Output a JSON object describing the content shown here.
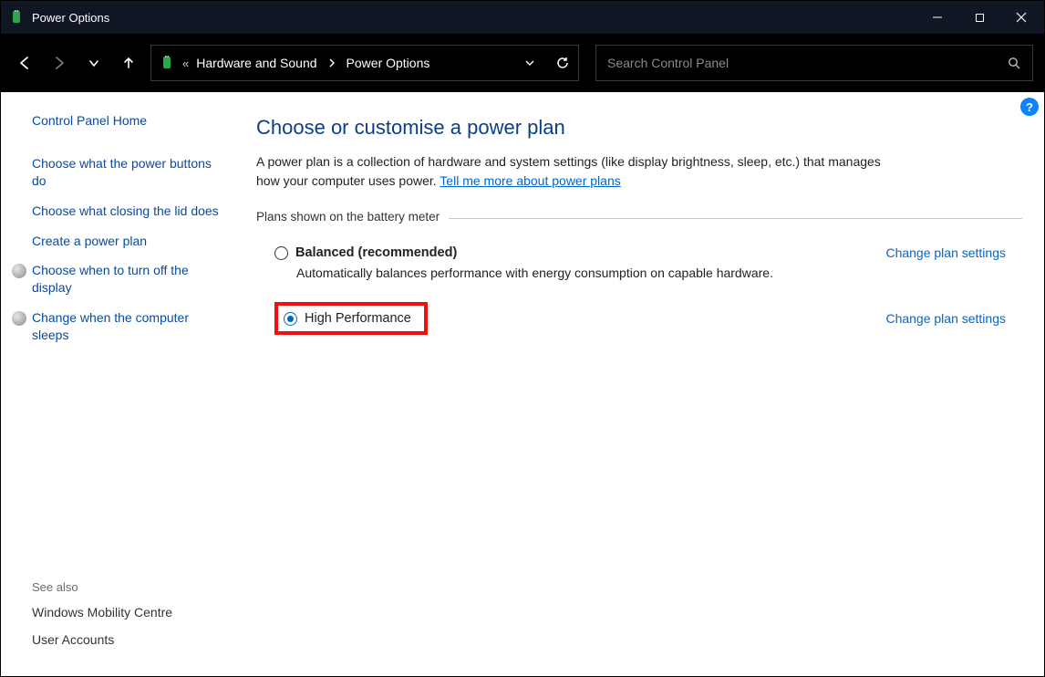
{
  "window": {
    "title": "Power Options"
  },
  "breadcrumb": {
    "prefix": "«",
    "parent": "Hardware and Sound",
    "current": "Power Options"
  },
  "search": {
    "placeholder": "Search Control Panel"
  },
  "sidebar": {
    "home": "Control Panel Home",
    "links": [
      "Choose what the power buttons do",
      "Choose what closing the lid does",
      "Create a power plan",
      "Choose when to turn off the display",
      "Change when the computer sleeps"
    ],
    "see_also_label": "See also",
    "see_also": [
      "Windows Mobility Centre",
      "User Accounts"
    ]
  },
  "main": {
    "heading": "Choose or customise a power plan",
    "intro": "A power plan is a collection of hardware and system settings (like display brightness, sleep, etc.) that manages how your computer uses power. ",
    "intro_link": "Tell me more about power plans",
    "fieldset_label": "Plans shown on the battery meter",
    "plans": [
      {
        "name": "Balanced (recommended)",
        "desc": "Automatically balances performance with energy consumption on capable hardware.",
        "selected": false,
        "change": "Change plan settings"
      },
      {
        "name": "High Performance",
        "desc": "",
        "selected": true,
        "change": "Change plan settings"
      }
    ]
  }
}
